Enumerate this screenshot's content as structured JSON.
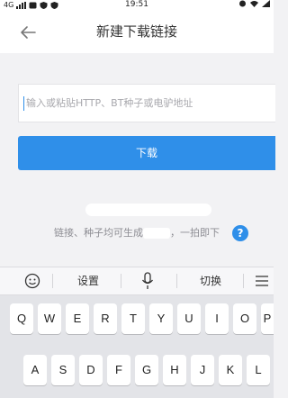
{
  "status_bar": {
    "network": "4G",
    "time": "19:51"
  },
  "header": {
    "title": "新建下载链接",
    "back_icon": "arrow-left-icon"
  },
  "url_input": {
    "placeholder": "输入或粘贴HTTP、BT种子或电驴地址",
    "value": ""
  },
  "download_button": {
    "label": "下载"
  },
  "tip": {
    "text_before": "链接、种子均可生成",
    "text_after": "，一拍即下",
    "help_icon": "question-icon"
  },
  "keyboard_toolbar": {
    "emoji_icon": "emoji-icon",
    "settings": "设置",
    "mic_icon": "microphone-icon",
    "switch": "切换",
    "menu_icon": "keyboard-menu-icon"
  },
  "keyboard": {
    "row1": [
      "Q",
      "W",
      "E",
      "R",
      "T",
      "Y",
      "U",
      "I",
      "O",
      "P"
    ],
    "row2": [
      "A",
      "S",
      "D",
      "F",
      "G",
      "H",
      "J",
      "K",
      "L"
    ]
  },
  "colors": {
    "accent": "#2f8fe9",
    "background": "#f2f2f4"
  }
}
